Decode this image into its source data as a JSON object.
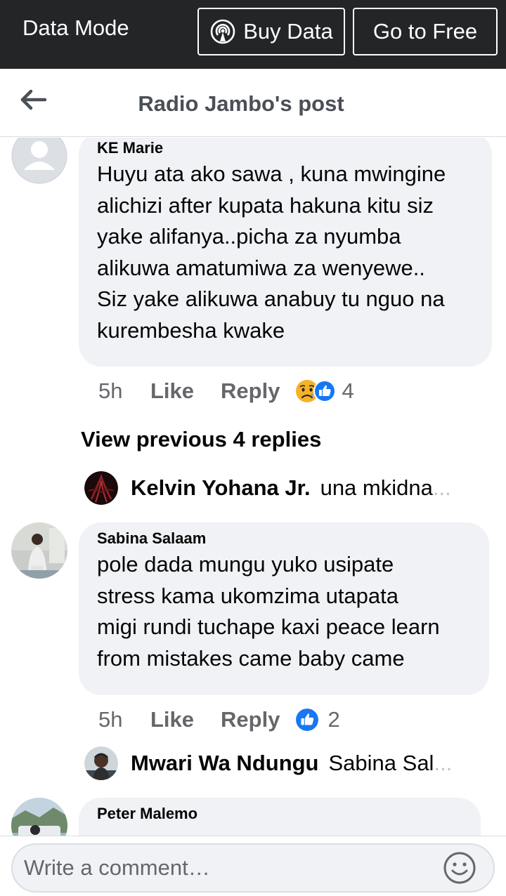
{
  "databar": {
    "mode_label": "Data Mode",
    "buy_label": "Buy Data",
    "free_label": "Go to Free"
  },
  "header": {
    "title": "Radio Jambo's post"
  },
  "comments": [
    {
      "name": "KE Marie",
      "lines": [
        "Huyu ata ako sawa , kuna mwingine",
        "alichizi after kupata hakuna kitu siz",
        "yake alifanya..picha za nyumba",
        "alikuwa amatumiwa za wenyewe..",
        "Siz yake alikuwa anabuy tu nguo na",
        "kurembesha kwake"
      ],
      "time": "5h",
      "like_label": "Like",
      "reply_label": "Reply",
      "reaction_count": "4",
      "reactions": [
        "sad-icon",
        "like-icon"
      ]
    },
    {
      "name": "Sabina Salaam",
      "lines": [
        "pole dada mungu yuko usipate",
        "stress kama ukomzima utapata",
        "migi rundi tuchape kaxi peace learn",
        "from mistakes came baby came"
      ],
      "time": "5h",
      "like_label": "Like",
      "reply_label": "Reply",
      "reaction_count": "2",
      "reactions": [
        "like-icon"
      ]
    },
    {
      "name": "Peter Malemo"
    }
  ],
  "view_previous": "View previous 4 replies",
  "replies": [
    {
      "name": "Kelvin Yohana Jr.",
      "text": "una mkidna",
      "ellipsis": "..."
    },
    {
      "name": "Mwari Wa Ndungu",
      "text": "Sabina Sal",
      "ellipsis": "..."
    }
  ],
  "composer": {
    "placeholder": "Write a comment…"
  },
  "colors": {
    "databar_bg": "#242526",
    "bubble_bg": "#f0f2f5",
    "secondary_text": "#65676b",
    "like_blue": "#1877f2"
  }
}
